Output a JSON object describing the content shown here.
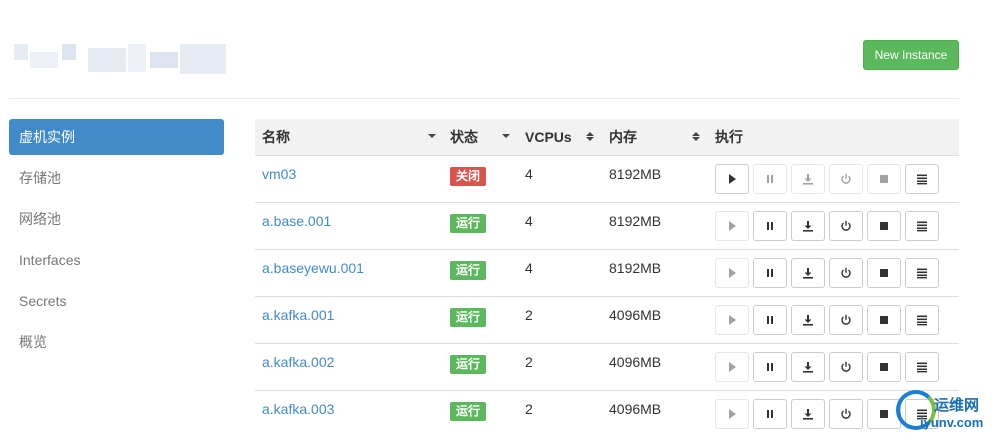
{
  "header": {
    "new_instance_label": "New Instance"
  },
  "sidebar": {
    "items": [
      {
        "label": "虚机实例",
        "active": true
      },
      {
        "label": "存储池",
        "active": false
      },
      {
        "label": "网络池",
        "active": false
      },
      {
        "label": "Interfaces",
        "active": false
      },
      {
        "label": "Secrets",
        "active": false
      },
      {
        "label": "概览",
        "active": false
      }
    ]
  },
  "table": {
    "columns": [
      "名称",
      "状态",
      "VCPUs",
      "内存",
      "执行"
    ],
    "rows": [
      {
        "name": "vm03",
        "status": "关闭",
        "vcpus": "4",
        "memory": "8192MB"
      },
      {
        "name": "a.base.001",
        "status": "运行",
        "vcpus": "4",
        "memory": "8192MB"
      },
      {
        "name": "a.baseyewu.001",
        "status": "运行",
        "vcpus": "4",
        "memory": "8192MB"
      },
      {
        "name": "a.kafka.001",
        "status": "运行",
        "vcpus": "2",
        "memory": "4096MB"
      },
      {
        "name": "a.kafka.002",
        "status": "运行",
        "vcpus": "2",
        "memory": "4096MB"
      },
      {
        "name": "a.kafka.003",
        "status": "运行",
        "vcpus": "2",
        "memory": "4096MB"
      }
    ]
  },
  "watermark": {
    "line1": "运维网",
    "line2": "iyunv.com"
  },
  "colors": {
    "primary": "#428bca",
    "success": "#5cb85c",
    "danger": "#d9534f"
  }
}
